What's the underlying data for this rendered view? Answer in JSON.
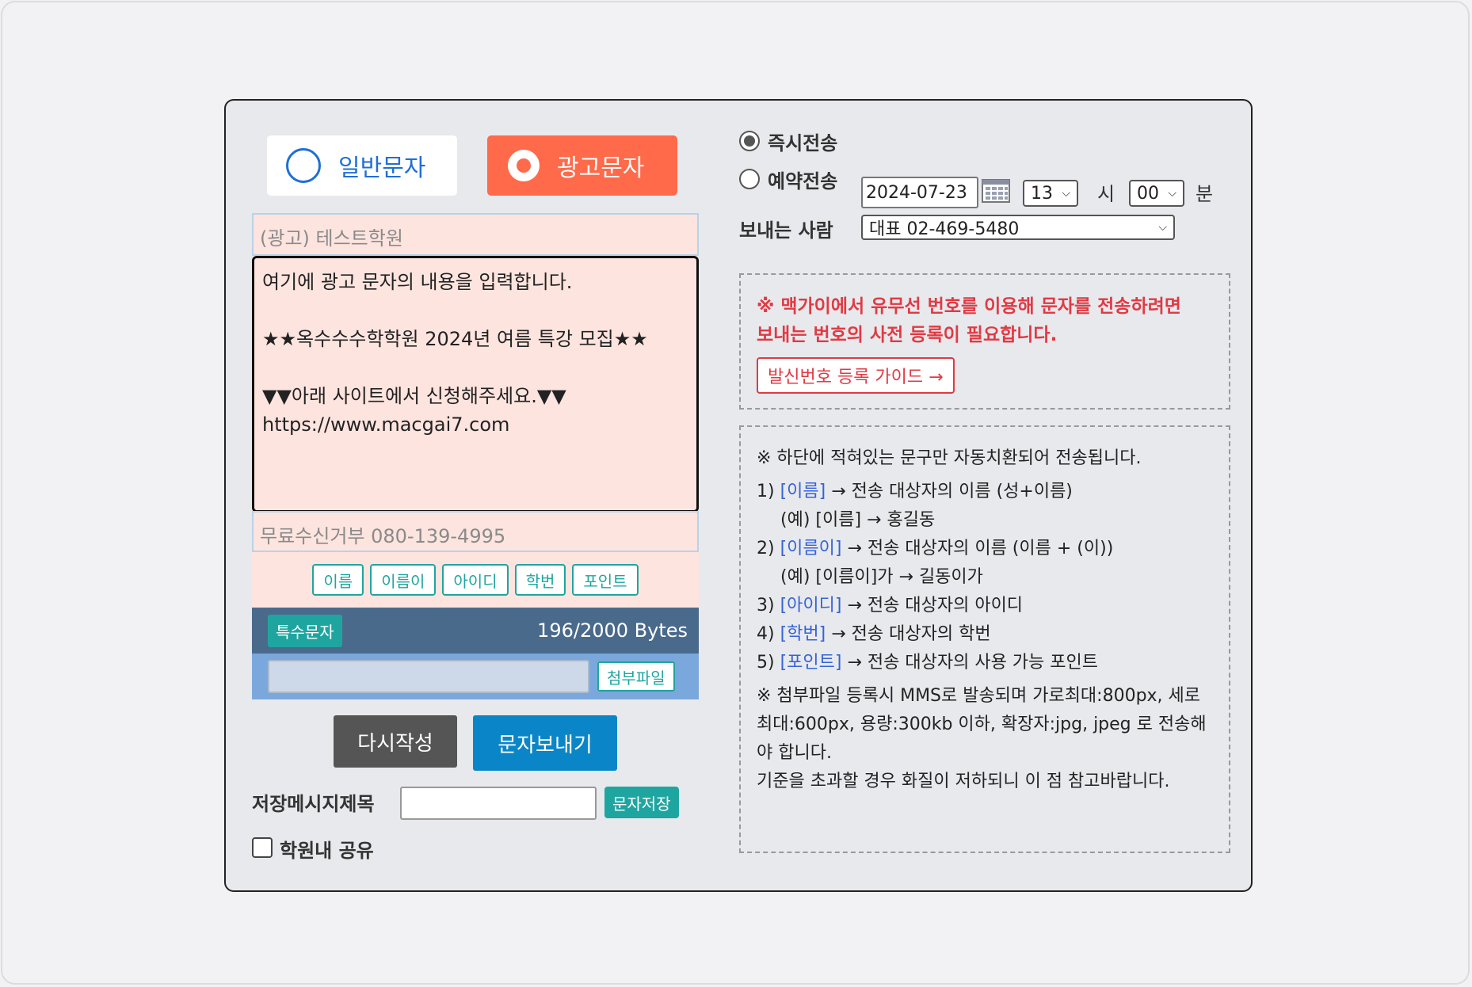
{
  "message_type": {
    "normal_label": "일반문자",
    "ad_label": "광고문자",
    "selected": "ad"
  },
  "message": {
    "prefix": "(광고) 테스트학원",
    "body": "여기에 광고 문자의 내용을 입력합니다.\n\n★★옥수수수학학원 2024년 여름 특강 모집★★\n\n▼▼아래 사이트에서 신청해주세요.▼▼\nhttps://www.macgai7.com",
    "suffix": "무료수신거부 080-139-4995"
  },
  "variables": [
    "이름",
    "이름이",
    "아이디",
    "학번",
    "포인트"
  ],
  "toolbar": {
    "special_chars": "특수문자",
    "bytes": "196/2000 Bytes",
    "attach_label": "첨부파일"
  },
  "actions": {
    "reset_label": "다시작성",
    "send_label": "문자보내기"
  },
  "save": {
    "label": "저장메시지제목",
    "button": "문자저장",
    "share_label": "학원내 공유"
  },
  "schedule": {
    "immediate_label": "즉시전송",
    "reserved_label": "예약전송",
    "selected": "immediate",
    "date": "2024-07-23",
    "hour": "13",
    "hour_unit": "시",
    "minute": "00",
    "minute_unit": "분"
  },
  "sender": {
    "label": "보내는 사람",
    "value": "대표 02-469-5480"
  },
  "notice": {
    "warning_line1": "※ 맥가이에서 유무선 번호를 이용해 문자를 전송하려면",
    "warning_line2": "보내는 번호의 사전 등록이 필요합니다.",
    "guide_button": "발신번호 등록 가이드 →"
  },
  "info": {
    "intro": "※ 하단에 적혀있는 문구만 자동치환되어 전송됩니다.",
    "items": [
      {
        "num": "1)",
        "kw": "[이름]",
        "desc": " → 전송 대상자의 이름 (성+이름)",
        "example": "(예) [이름] → 홍길동"
      },
      {
        "num": "2)",
        "kw": "[이름이]",
        "desc": " → 전송 대상자의 이름 (이름 + (이))",
        "example": "(예) [이름이]가 → 길동이가"
      },
      {
        "num": "3)",
        "kw": "[아이디]",
        "desc": " → 전송 대상자의 아이디"
      },
      {
        "num": "4)",
        "kw": "[학번]",
        "desc": " → 전송 대상자의 학번"
      },
      {
        "num": "5)",
        "kw": "[포인트]",
        "desc": " → 전송 대상자의 사용 가능 포인트"
      }
    ],
    "attach_note": "※ 첨부파일 등록시 MMS로 발송되며 가로최대:800px, 세로최대:600px, 용량:300kb 이하, 확장자:jpg, jpeg 로 전송해야 합니다.",
    "quality_note": "기준을 초과할 경우 화질이 저하되니 이 점 참고바랍니다."
  },
  "colors": {
    "ad_accent": "#ff6a4a",
    "normal_accent": "#1f6fd6",
    "teal": "#1fa5a0",
    "send_blue": "#0a86c8",
    "warning_red": "#e03a44",
    "keyword_blue": "#3563d6"
  }
}
